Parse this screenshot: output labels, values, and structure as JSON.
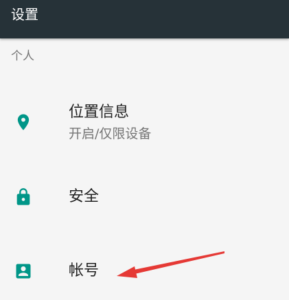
{
  "toolbar": {
    "title": "设置",
    "background_color": "#263238"
  },
  "section": {
    "header": "个人"
  },
  "items": [
    {
      "title": "位置信息",
      "summary": "开启/仅限设备",
      "icon": "location-pin-icon"
    },
    {
      "title": "安全",
      "icon": "lock-icon"
    },
    {
      "title": "帐号",
      "icon": "account-box-icon"
    }
  ],
  "colors": {
    "accent": "#009688",
    "annotation": "#e53935"
  },
  "annotation": {
    "type": "arrow",
    "points_to": "帐号"
  }
}
